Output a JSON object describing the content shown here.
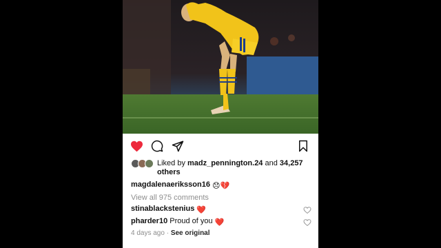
{
  "post": {
    "image_alt": "Footballer in yellow kit bent over on the pitch",
    "actions": {
      "like_icon": "heart-filled-icon",
      "comment_icon": "comment-icon",
      "share_icon": "share-icon",
      "save_icon": "bookmark-icon",
      "like_color": "#ed2a3d"
    },
    "likes": {
      "prefix": "Liked by ",
      "user": "madz_pennington.24",
      "conjunction": " and ",
      "count": "34,257",
      "suffix": "others"
    },
    "caption": {
      "username": "magdalenaeriksson16",
      "emoji": "😞💔"
    },
    "view_all_comments": "View all 975 comments",
    "comments": [
      {
        "username": "stinablackstenius",
        "text": "",
        "emoji": "❤️"
      },
      {
        "username": "pharder10",
        "text": "Proud of you",
        "emoji": "❤️"
      }
    ],
    "meta": {
      "time": "4 days ago",
      "separator": " · ",
      "see_original": "See original"
    }
  }
}
